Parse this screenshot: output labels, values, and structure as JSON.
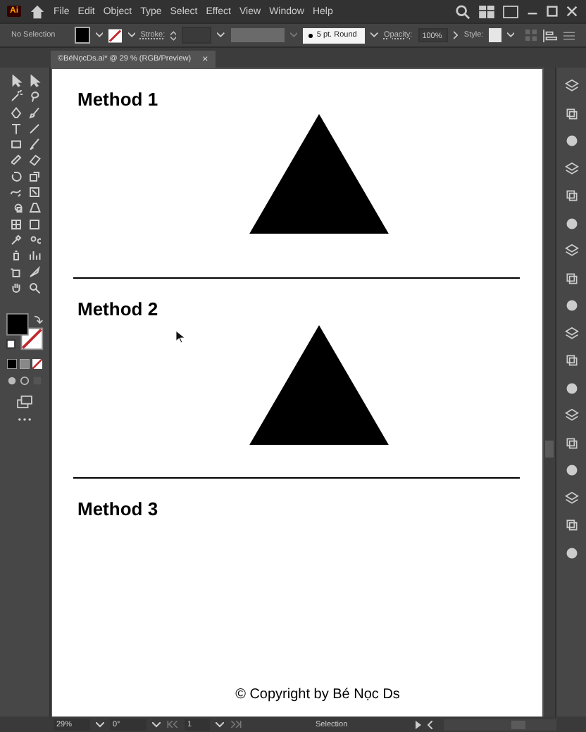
{
  "app": {
    "logo": "Ai"
  },
  "menu": [
    "File",
    "Edit",
    "Object",
    "Type",
    "Select",
    "Effect",
    "View",
    "Window",
    "Help"
  ],
  "control_bar": {
    "selection": "No Selection",
    "stroke_label": "Stroke:",
    "brush": "5 pt. Round",
    "opacity_label": "Opacity:",
    "opacity": "100%",
    "style_label": "Style:"
  },
  "document_tab": {
    "title": "©BéNọcDs.ai* @ 29 % (RGB/Preview)",
    "close": "×",
    "selected": true
  },
  "artboard": {
    "sections": [
      {
        "heading": "Method 1",
        "kind": "triangle",
        "cursor": false
      },
      {
        "heading": "Method 2",
        "kind": "triangle",
        "cursor": true
      },
      {
        "heading": "Method 3",
        "kind": "blank",
        "cursor": false
      }
    ],
    "copyright": "© Copyright by Bé Nọc Ds"
  },
  "status_bar": {
    "zoom": "29%",
    "rotation": "0°",
    "artboard": "1",
    "tool": "Selection"
  }
}
